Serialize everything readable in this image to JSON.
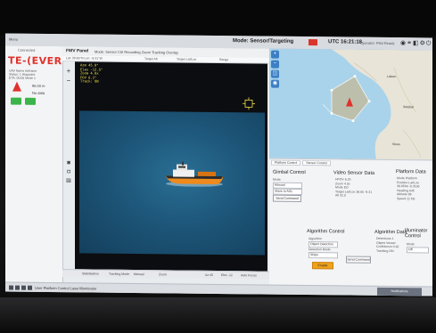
{
  "topbar": {
    "menu": "Menu",
    "mode_label": "Mode: Sensor/Targeting",
    "utc": "UTC 16:21:18",
    "user": "Operator: Pilot Ready",
    "icons": [
      "gps-icon",
      "link-icon",
      "camera-icon",
      "settings-icon",
      "power-icon"
    ]
  },
  "left_panel": {
    "connection": "Connected",
    "logo": "TE-(EVER",
    "info_lines": [
      "UAV Name    Airframe",
      "Status: 1   Waypoint",
      "ETA: 00:00  Mode 1"
    ],
    "altitude": "96.00 m",
    "no_data": "No data"
  },
  "fmv": {
    "title": "FMV Panel",
    "options": "Mode:  Sensor Ctrl     Recording      Zoom      Tracking      Overlay",
    "sub": [
      "Lat: 38.65°N  Lon: -9.31°W",
      "Target Alt",
      "Target Lat/Lon",
      "Range"
    ],
    "osd": [
      "Azm 45.0°",
      "Elev -12.5°",
      "Zoom 4.0x",
      "FOV 6.2°",
      "Track: ON"
    ],
    "bottom": [
      "Stabilisation",
      "Tracking Mode",
      "Manual",
      "Zoom",
      "Az 45",
      "Elev -12",
      "Auto Focus"
    ]
  },
  "map": {
    "places": [
      "Lisbon",
      "Setúbal",
      "Sines"
    ]
  },
  "lower": {
    "tabs": [
      "Platform Control",
      "Sensor Control"
    ],
    "gimbal_title": "Gimbal Control",
    "gimbal_fields": [
      "Mode",
      "Manual",
      "Slave to AGL"
    ],
    "gimbal_button": "Send Command",
    "video_title": "Video Sensor Data",
    "video_values": [
      "HFOV 6.20",
      "Zoom 4.0x",
      "Mode EO",
      "Target Lat/Lon 38.65 -9.31",
      "Alt 32.0"
    ],
    "platform_title": "Platform Data",
    "platform_values": [
      "Mode Platform",
      "Position Lat/Lon",
      "38.6500 -9.3100",
      "Heading 045",
      "Altitude 96",
      "Speed 22 kts"
    ],
    "algo_title": "Algorithm Control",
    "algo_fields": [
      "Algorithm",
      "Object Detection",
      "Detection Mode",
      "Ships"
    ],
    "algo_button": "Enable",
    "algo_send": "Send Command",
    "algo_data_title": "Algorithm Data",
    "algo_data": [
      "Detections 1",
      "Object Vessel",
      "Confidence 0.92",
      "Tracking ON"
    ],
    "illum_title": "Illuminator Control",
    "illum_fields": [
      "Mode",
      "Off"
    ]
  },
  "taskbar": {
    "items": "User Platform Control    Laser/Illuminator",
    "notification": "Notifications"
  },
  "colors": {
    "brand": "#e0322b",
    "accent": "#3bb54a",
    "warning": "#f0a21a",
    "sea": "#1d5679",
    "osd": "#f2e04a"
  }
}
